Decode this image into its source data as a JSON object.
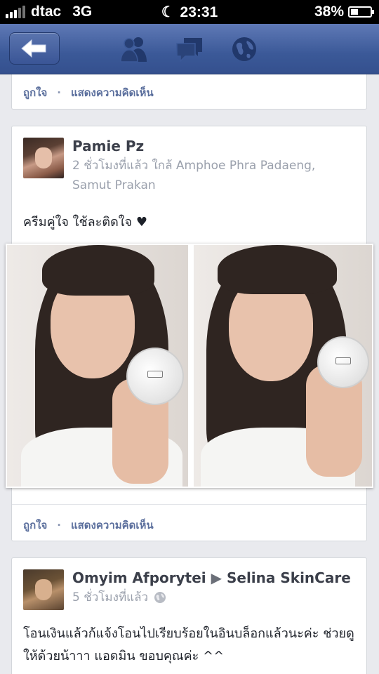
{
  "status_bar": {
    "carrier": "dtac",
    "network": "3G",
    "time": "23:31",
    "battery": "38%",
    "battery_level": 0.38
  },
  "nav": {
    "icons": [
      "back-arrow-icon",
      "friends-icon",
      "messages-icon",
      "globe-icon"
    ]
  },
  "actions": {
    "like": "ถูกใจ",
    "separator": "·",
    "comment": "แสดงความคิดเห็น"
  },
  "posts": [
    {
      "author": "Pamie Pz",
      "meta": "2 ชั่วโมงที่แล้ว ใกล้ Amphoe Phra Padaeng, Samut Prakan",
      "text": "ครีมคู่ใจ ใช้ละติดใจ ♥"
    },
    {
      "author": "Omyim Afporytei",
      "target_arrow": "▶",
      "target": "Selina SkinCare",
      "meta": "5 ชั่วโมงที่แล้ว",
      "text": "โอนเงินแล้วก้แจ้งโอนไปเรียบร้อยในอินบล็อกแล้วนะค่ะ ช่วยดูให้ด้วยน้าาา แอดมิน ขอบคุณค่ะ ^^"
    }
  ],
  "colors": {
    "nav": "#3b5998",
    "link": "#5b6f9d",
    "background": "#e9eaee"
  }
}
